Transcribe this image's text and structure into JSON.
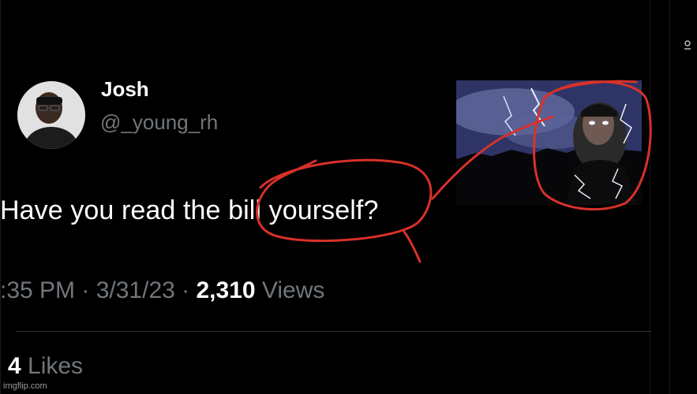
{
  "tweet": {
    "author": {
      "display_name": "Josh",
      "handle": "@_young_rh"
    },
    "text_before": "Have you read the ",
    "text_circled": "bill yourself?",
    "meta": {
      "time": ":35 PM",
      "sep1": " · ",
      "date": "3/31/23",
      "sep2": " · ",
      "views_count": "2,310",
      "views_label": " Views"
    },
    "likes": {
      "count": "4",
      "label": " Likes"
    }
  },
  "annotation": {
    "stroke_color": "#d8312a"
  },
  "watermark": {
    "text": "imgflip.com"
  }
}
